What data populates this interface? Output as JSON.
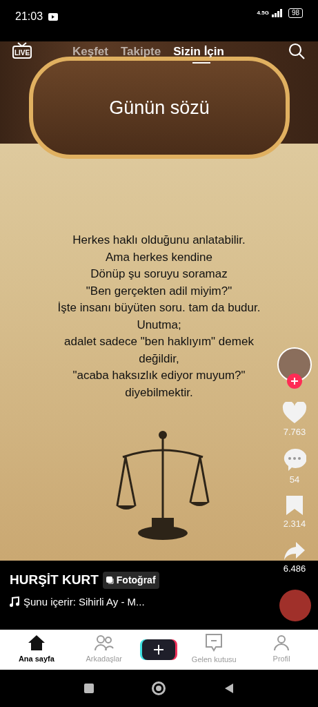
{
  "status_bar": {
    "time": "21:03",
    "battery": "98",
    "network": "4.5G"
  },
  "live_label": "LIVE",
  "top_tabs": [
    {
      "label": "Keşfet",
      "selected": false
    },
    {
      "label": "Takipte",
      "selected": false
    },
    {
      "label": "Sizin İçin",
      "selected": true
    }
  ],
  "post": {
    "title": "Günün sözü",
    "quote_lines": [
      "Herkes haklı olduğunu anlatabilir.",
      "Ama herkes kendine",
      "Dönüp şu soruyu soramaz",
      "\"Ben gerçekten adil miyim?\"",
      "İşte insanı büyüten soru. tam da budur.",
      "Unutma;",
      "adalet sadece \"ben haklıyım\" demek",
      "değildir,",
      "\"acaba haksızlık ediyor muyum?\"",
      "diyebilmektir."
    ]
  },
  "actions": [
    {
      "kind": "like",
      "count": "7.763"
    },
    {
      "kind": "comment",
      "count": "54"
    },
    {
      "kind": "save",
      "count": "2.314"
    },
    {
      "kind": "share",
      "count": "6.486"
    }
  ],
  "author": {
    "name": "HURŞİT KURT",
    "badge": "Fotoğraf",
    "music": "Şunu içerir: Sihirli Ay - M..."
  },
  "bottom_nav": [
    {
      "kind": "home",
      "label": "Ana sayfa",
      "selected": true
    },
    {
      "kind": "friends",
      "label": "Arkadaşlar",
      "selected": false
    },
    {
      "kind": "create"
    },
    {
      "kind": "inbox",
      "label": "Gelen kutusu",
      "selected": false
    },
    {
      "kind": "profile",
      "label": "Profil",
      "selected": false
    }
  ]
}
